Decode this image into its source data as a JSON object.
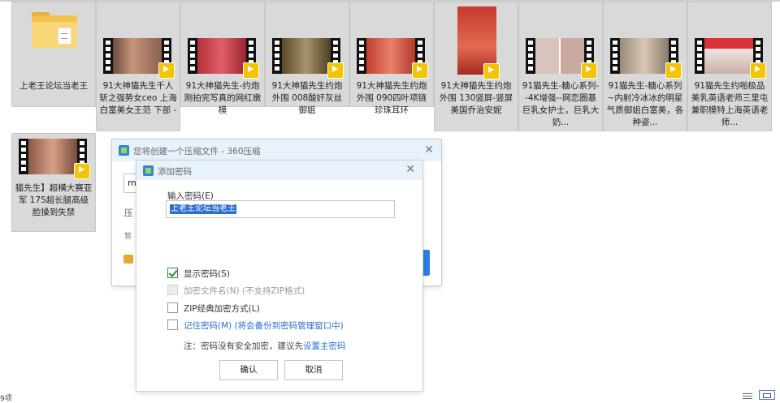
{
  "files": [
    {
      "name": "上老王论坛当老王",
      "type": "folder"
    },
    {
      "name": "91大神猫先生千人斩之强势女ceo 上海 白富美女王范 下部 -",
      "type": "video",
      "badge": "Player"
    },
    {
      "name": "91大神猫先生-约炮刚拍完写真的网红嫩模",
      "type": "video",
      "badge": "Player"
    },
    {
      "name": "91大神猫先生约炮外围 008酸奸灰丝御姐",
      "type": "video",
      "badge": "Player"
    },
    {
      "name": "91大神猫先生约炮外围 090四叶项链珍珠耳环",
      "type": "video",
      "badge": "Player"
    },
    {
      "name": "91大神猫先生约炮外围 130竖屏-竖屏美国乔治安妮",
      "type": "video",
      "badge": "Player"
    },
    {
      "name": "91猫先生-糖心系列--4K增强--网恋圈基巨乳女护士，巨乳大奶...",
      "type": "video",
      "badge": "Player"
    },
    {
      "name": "91猫先生-糖心系列~内射冷冰冰的明星气质御姐白富美，各种姿...",
      "type": "video",
      "badge": "Player"
    },
    {
      "name": "91猫先生约啪极品美乳英语老师三里屯兼职模特上海英语老师...",
      "type": "video",
      "badge": "Player"
    },
    {
      "name": "猫先生】超横大赛亚军 175超长腿高级脸操到失禁",
      "type": "video",
      "badge": "Player"
    }
  ],
  "compress_dialog": {
    "title": "您将创建一个压缩文件 - 360压缩",
    "close": "✕",
    "partial_labels": [
      "m",
      "压",
      "暂"
    ]
  },
  "password_dialog": {
    "title": "添加密码",
    "close": "✕",
    "password_label": "输入密码(E)",
    "password_value": "上老王论坛当老王",
    "options": [
      {
        "label": "显示密码(S)",
        "checked": true,
        "enabled": true
      },
      {
        "label": "加密文件名(N) (不支持ZIP格式)",
        "checked": false,
        "enabled": false
      },
      {
        "label": "ZIP经典加密方式(L)",
        "checked": false,
        "enabled": true
      },
      {
        "label": "记住密码(M)  (将会备份到密码管理窗口中)",
        "checked": false,
        "enabled": true
      }
    ],
    "note_prefix": "注：密码没有安全加密，建议先",
    "note_link": "设置主密码",
    "ok": "确认",
    "cancel": "取消"
  },
  "status": {
    "left": "9项"
  },
  "colors": {
    "accent": "#2c6fd0",
    "folder": "#f2c24c",
    "tile_bg": "#d9d9d9",
    "title_bar": "#e9f1fa"
  }
}
